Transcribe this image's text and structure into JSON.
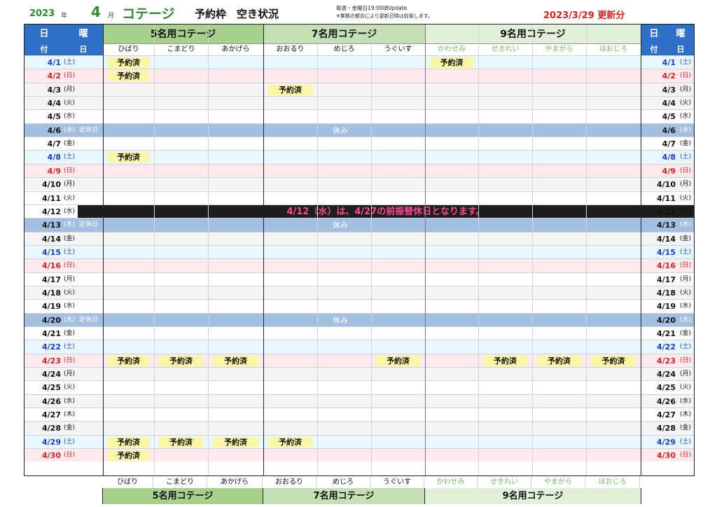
{
  "header": {
    "year": "2023",
    "year_suffix": "年",
    "month": "4",
    "month_suffix": "月",
    "category": "コテージ",
    "title": "予約枠　空き状況",
    "note1": "毎週・金曜日19:00頃Update",
    "note2": "※業務の都合により更新日時は前後します。",
    "updated": "2023/3/29 更新分"
  },
  "day_header": {
    "top_left": "日",
    "top_right": "曜",
    "bottom_left": "付",
    "bottom_right": "日"
  },
  "groups": [
    {
      "name": "5名用コテージ",
      "cottages": [
        "ひばり",
        "こまどり",
        "あかげら"
      ]
    },
    {
      "name": "7名用コテージ",
      "cottages": [
        "おおるり",
        "めじろ",
        "うぐいす"
      ]
    },
    {
      "name": "9名用コテージ",
      "cottages": [
        "かわせみ",
        "せきれい",
        "やまがら",
        "ほおじろ"
      ]
    }
  ],
  "booked_label": "予約済",
  "closed_label": "定休日",
  "rest_label": "休み",
  "announcement": "4/12（水）は、4/27の前振替休日となります。",
  "days": [
    {
      "date": "4/1",
      "wd": "(土)",
      "type": "sat",
      "booked": [
        0,
        6
      ]
    },
    {
      "date": "4/2",
      "wd": "(日)",
      "type": "sun",
      "booked": [
        0
      ]
    },
    {
      "date": "4/3",
      "wd": "(月)",
      "type": "alt",
      "booked": [
        3
      ]
    },
    {
      "date": "4/4",
      "wd": "(火)",
      "type": "alt",
      "booked": []
    },
    {
      "date": "4/5",
      "wd": "(水)",
      "type": "",
      "booked": []
    },
    {
      "date": "4/6",
      "wd": "(木)",
      "type": "off",
      "booked": []
    },
    {
      "date": "4/7",
      "wd": "(金)",
      "type": "",
      "booked": []
    },
    {
      "date": "4/8",
      "wd": "(土)",
      "type": "sat",
      "booked": [
        0
      ]
    },
    {
      "date": "4/9",
      "wd": "(日)",
      "type": "sun",
      "booked": []
    },
    {
      "date": "4/10",
      "wd": "(月)",
      "type": "alt",
      "booked": []
    },
    {
      "date": "4/11",
      "wd": "(火)",
      "type": "",
      "booked": []
    },
    {
      "date": "4/12",
      "wd": "(水)",
      "type": "ann",
      "booked": []
    },
    {
      "date": "4/13",
      "wd": "(木)",
      "type": "off",
      "booked": []
    },
    {
      "date": "4/14",
      "wd": "(金)",
      "type": "alt",
      "booked": []
    },
    {
      "date": "4/15",
      "wd": "(土)",
      "type": "sat",
      "booked": []
    },
    {
      "date": "4/16",
      "wd": "(日)",
      "type": "sun",
      "booked": []
    },
    {
      "date": "4/17",
      "wd": "(月)",
      "type": "",
      "booked": []
    },
    {
      "date": "4/18",
      "wd": "(火)",
      "type": "alt",
      "booked": []
    },
    {
      "date": "4/19",
      "wd": "(水)",
      "type": "",
      "booked": []
    },
    {
      "date": "4/20",
      "wd": "(木)",
      "type": "off",
      "booked": []
    },
    {
      "date": "4/21",
      "wd": "(金)",
      "type": "",
      "booked": []
    },
    {
      "date": "4/22",
      "wd": "(土)",
      "type": "sat",
      "booked": []
    },
    {
      "date": "4/23",
      "wd": "(日)",
      "type": "sun",
      "booked": [
        0,
        1,
        2,
        5,
        7,
        8,
        9
      ]
    },
    {
      "date": "4/24",
      "wd": "(月)",
      "type": "alt",
      "booked": []
    },
    {
      "date": "4/25",
      "wd": "(火)",
      "type": "",
      "booked": []
    },
    {
      "date": "4/26",
      "wd": "(水)",
      "type": "alt",
      "booked": []
    },
    {
      "date": "4/27",
      "wd": "(木)",
      "type": "",
      "booked": []
    },
    {
      "date": "4/28",
      "wd": "(金)",
      "type": "alt",
      "booked": []
    },
    {
      "date": "4/29",
      "wd": "(土)",
      "type": "sat",
      "booked": [
        0,
        1,
        2,
        3
      ]
    },
    {
      "date": "4/30",
      "wd": "(日)",
      "type": "sun",
      "booked": [
        0
      ]
    }
  ],
  "colors": {
    "group5": "#a8d08d",
    "group7": "#c5e0b4",
    "group9": "#e2efd9",
    "booked": "#fbf6a4",
    "closed": "#a2bfe2",
    "announce_bg": "#1d1d1d",
    "announce_text": "#ff4a98",
    "saturday": "#1a3bd6",
    "sunday": "#e0201e"
  }
}
